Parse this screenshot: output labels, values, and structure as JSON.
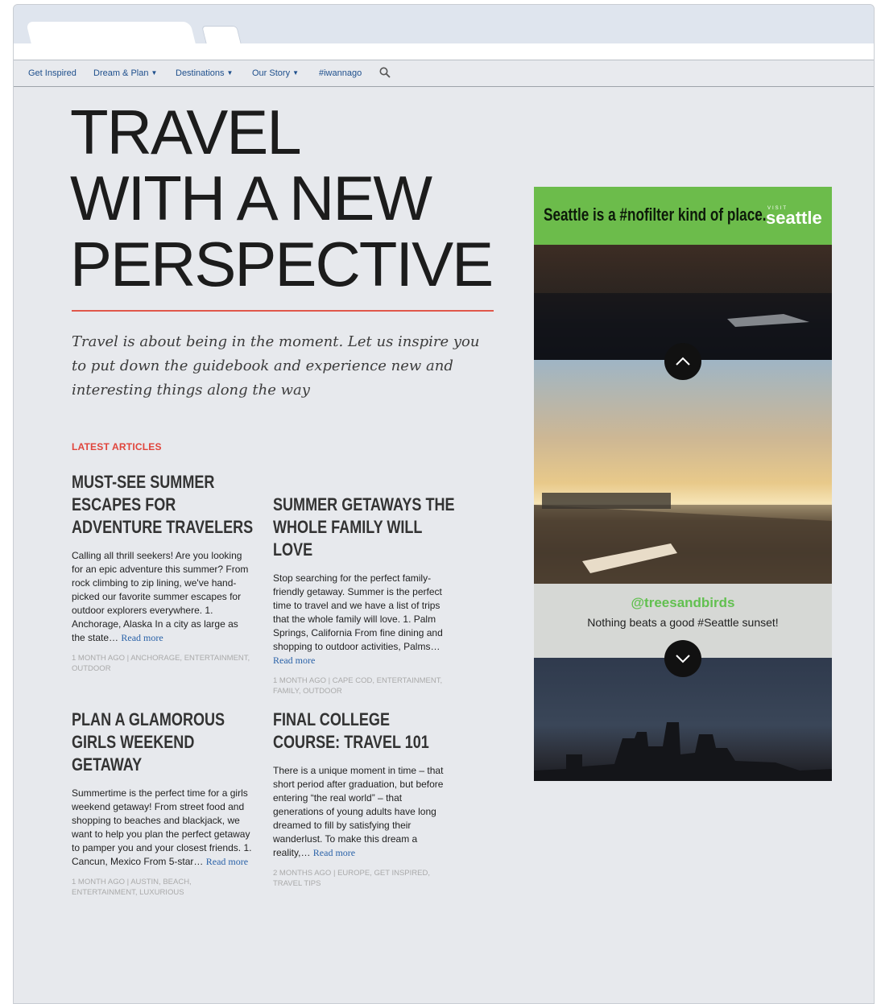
{
  "nav": {
    "items": [
      {
        "label": "Get Inspired",
        "dropdown": false
      },
      {
        "label": "Dream & Plan",
        "dropdown": true
      },
      {
        "label": "Destinations",
        "dropdown": true
      },
      {
        "label": "Our Story",
        "dropdown": true
      },
      {
        "label": "#iwannago",
        "dropdown": false
      }
    ],
    "search_icon": "search-icon"
  },
  "hero": {
    "lines": [
      "TRAVEL",
      "WITH A NEW",
      "PERSPECTIVE"
    ],
    "intro": "Travel is about being in the moment. Let us inspire you to put down the guidebook and experience new and interesting things along the way"
  },
  "latest_heading": "LATEST ARTICLES",
  "read_more_label": "Read more",
  "articles": [
    {
      "title": "MUST-SEE SUMMER ESCAPES FOR ADVENTURE TRAVELERS",
      "excerpt": "Calling all thrill seekers! Are you looking for an epic adventure this summer? From rock climbing to zip lining, we've hand-picked our favorite summer escapes for outdoor explorers everywhere. 1. Anchorage, Alaska In a city as large as the state…",
      "meta": "1 MONTH AGO | ANCHORAGE, ENTERTAINMENT, OUTDOOR"
    },
    {
      "title": "SUMMER GETAWAYS THE WHOLE FAMILY WILL LOVE",
      "excerpt": "Stop searching for the perfect family-friendly getaway. Summer is the perfect time to travel and we have a list of trips that the whole family will love. 1. Palm Springs, California From fine dining and shopping to outdoor activities, Palms…",
      "meta": "1 MONTH AGO | CAPE COD, ENTERTAINMENT, FAMILY, OUTDOOR"
    },
    {
      "title": "PLAN A GLAMOROUS GIRLS WEEKEND GETAWAY",
      "excerpt": "Summertime is the perfect time for a girls weekend getaway! From street food and shopping to beaches and blackjack, we want to help you plan the perfect getaway to pamper you and your closest friends. 1. Cancun, Mexico From 5-star…",
      "meta": "1 MONTH AGO | AUSTIN, BEACH, ENTERTAINMENT, LUXURIOUS"
    },
    {
      "title": "FINAL COLLEGE COURSE: TRAVEL 101",
      "excerpt": "There is a unique moment in time – that short period after graduation, but before entering “the real world” – that generations of young adults have long dreamed to fill by satisfying their wanderlust. To make this dream a reality,…",
      "meta": "2 MONTHS AGO | EUROPE, GET INSPIRED, TRAVEL TIPS"
    }
  ],
  "widget": {
    "banner_text": "Seattle is a #nofilter kind of place.",
    "logo_small": "VISIT",
    "logo": "seattle",
    "caption_user": "@treesandbirds",
    "caption_text": "Nothing beats a good #Seattle sunset!"
  },
  "colors": {
    "accent": "#e0453c",
    "link": "#2a62a8",
    "banner_green": "#6cbc4b",
    "caption_green": "#62c050"
  }
}
